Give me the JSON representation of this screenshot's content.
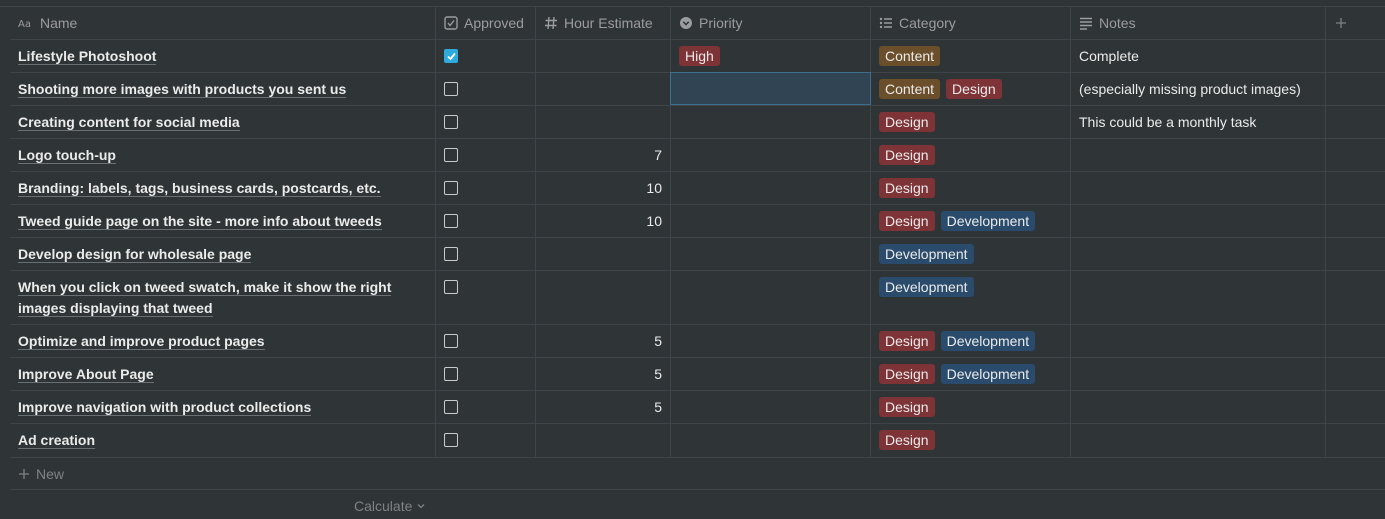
{
  "columns": {
    "name": "Name",
    "approved": "Approved",
    "hours": "Hour Estimate",
    "priority": "Priority",
    "category": "Category",
    "notes": "Notes"
  },
  "colors": {
    "content_tag": "#6b4e2a",
    "design_tag": "#7e3337",
    "development_tag": "#2a4b6b",
    "high_tag": "#7e3337",
    "checkbox_checked": "#2eaadc",
    "selected_cell": "#304453"
  },
  "rows": [
    {
      "name": "Lifestyle Photoshoot",
      "approved": true,
      "hours": "",
      "priority": "High",
      "tags": [
        "Content"
      ],
      "notes": "Complete"
    },
    {
      "name": "Shooting more images with products you sent us",
      "approved": false,
      "hours": "",
      "priority": "",
      "tags": [
        "Content",
        "Design"
      ],
      "notes": "(especially missing product images)"
    },
    {
      "name": "Creating content for social media",
      "approved": false,
      "hours": "",
      "priority": "",
      "tags": [
        "Design"
      ],
      "notes": "This could be a monthly task"
    },
    {
      "name": "Logo touch-up",
      "approved": false,
      "hours": "7",
      "priority": "",
      "tags": [
        "Design"
      ],
      "notes": ""
    },
    {
      "name": "Branding: labels, tags, business cards, postcards, etc.",
      "approved": false,
      "hours": "10",
      "priority": "",
      "tags": [
        "Design"
      ],
      "notes": ""
    },
    {
      "name": "Tweed guide page on the site - more info about tweeds",
      "approved": false,
      "hours": "10",
      "priority": "",
      "tags": [
        "Design",
        "Development"
      ],
      "notes": ""
    },
    {
      "name": "Develop design for wholesale page",
      "approved": false,
      "hours": "",
      "priority": "",
      "tags": [
        "Development"
      ],
      "notes": ""
    },
    {
      "name": "When you click on tweed swatch, make it show the right images displaying that tweed",
      "approved": false,
      "hours": "",
      "priority": "",
      "tags": [
        "Development"
      ],
      "notes": ""
    },
    {
      "name": "Optimize and improve product pages",
      "approved": false,
      "hours": "5",
      "priority": "",
      "tags": [
        "Design",
        "Development"
      ],
      "notes": ""
    },
    {
      "name": "Improve About Page",
      "approved": false,
      "hours": "5",
      "priority": "",
      "tags": [
        "Design",
        "Development"
      ],
      "notes": ""
    },
    {
      "name": "Improve navigation with product collections",
      "approved": false,
      "hours": "5",
      "priority": "",
      "tags": [
        "Design"
      ],
      "notes": ""
    },
    {
      "name": "Ad creation",
      "approved": false,
      "hours": "",
      "priority": "",
      "tags": [
        "Design"
      ],
      "notes": ""
    }
  ],
  "footer": {
    "new_label": "New",
    "calculate_label": "Calculate"
  }
}
